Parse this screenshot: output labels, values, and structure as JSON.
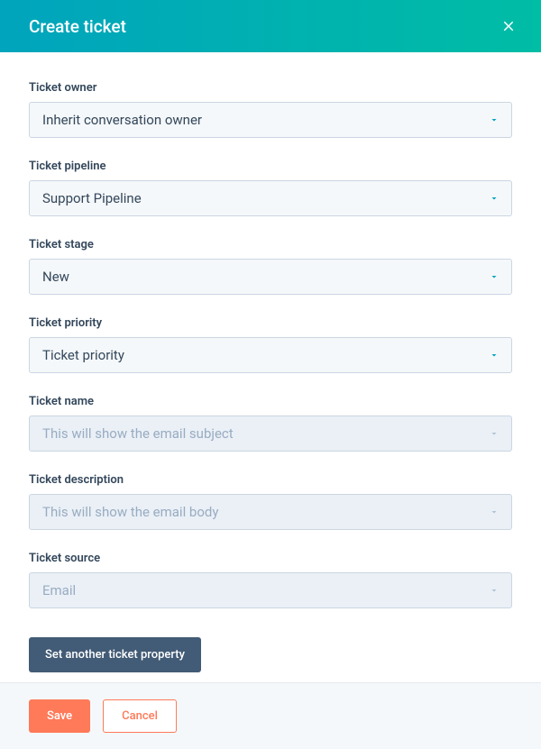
{
  "header": {
    "title": "Create ticket"
  },
  "fields": {
    "owner": {
      "label": "Ticket owner",
      "value": "Inherit conversation owner"
    },
    "pipeline": {
      "label": "Ticket pipeline",
      "value": "Support Pipeline"
    },
    "stage": {
      "label": "Ticket stage",
      "value": "New"
    },
    "priority": {
      "label": "Ticket priority",
      "value": "Ticket priority"
    },
    "name": {
      "label": "Ticket name",
      "value": "This will show the email subject"
    },
    "description": {
      "label": "Ticket description",
      "value": "This will show the email body"
    },
    "source": {
      "label": "Ticket source",
      "value": "Email"
    }
  },
  "buttons": {
    "set_property": "Set another ticket property",
    "save": "Save",
    "cancel": "Cancel"
  }
}
